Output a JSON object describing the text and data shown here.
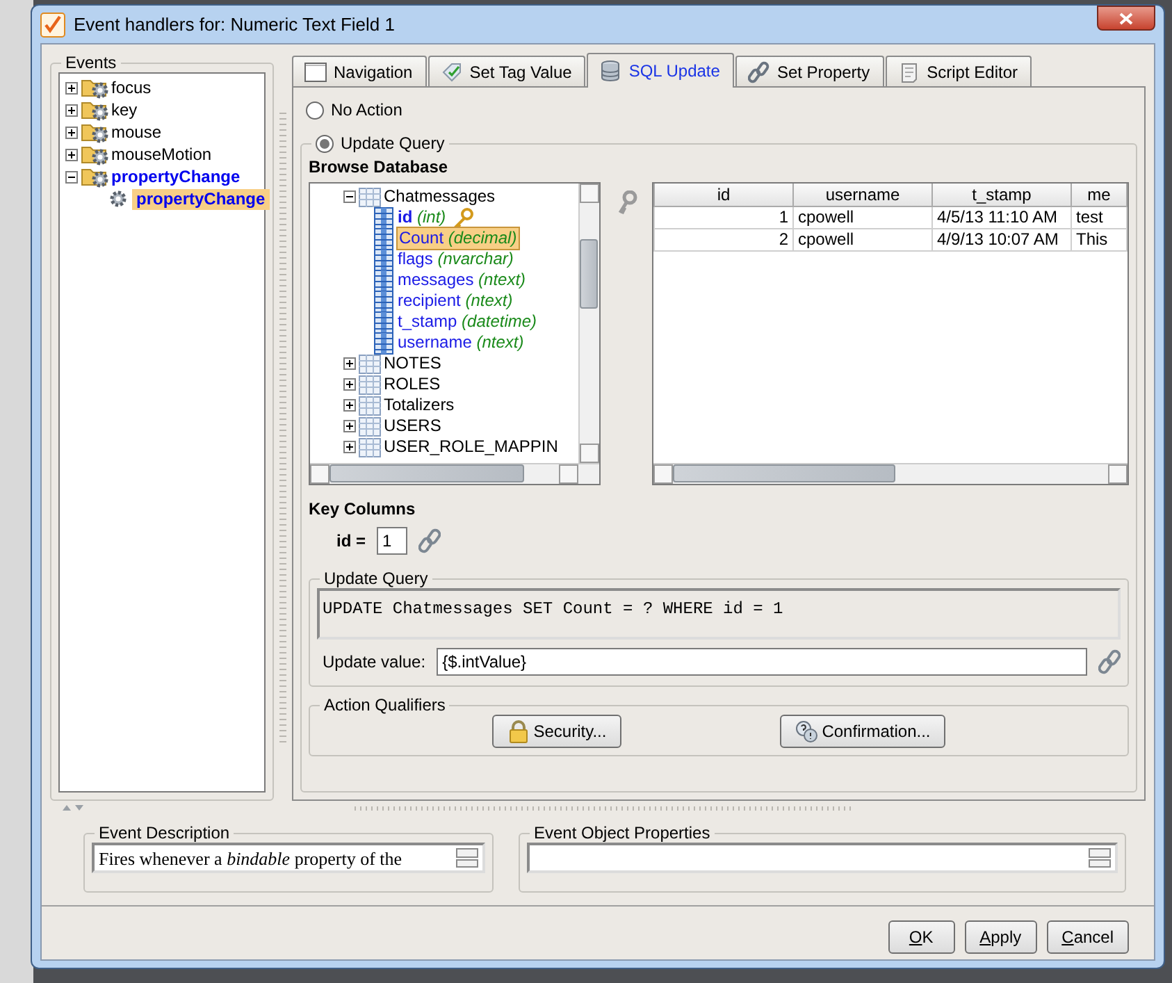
{
  "window": {
    "title": "Event handlers for: Numeric Text Field 1"
  },
  "events": {
    "title": "Events",
    "tree": [
      {
        "label": "focus",
        "expanded": false,
        "configured": false
      },
      {
        "label": "key",
        "expanded": false,
        "configured": false
      },
      {
        "label": "mouse",
        "expanded": false,
        "configured": false
      },
      {
        "label": "mouseMotion",
        "expanded": false,
        "configured": false
      },
      {
        "label": "propertyChange",
        "expanded": true,
        "configured": true,
        "children": [
          {
            "label": "propertyChange",
            "configured": true,
            "selected": true
          }
        ]
      }
    ]
  },
  "tabs": [
    {
      "label": "Navigation",
      "selected": false,
      "kind": "page"
    },
    {
      "label": "Set Tag Value",
      "selected": false,
      "kind": "tag"
    },
    {
      "label": "SQL Update",
      "selected": true,
      "kind": "database"
    },
    {
      "label": "Set Property",
      "selected": false,
      "kind": "link"
    },
    {
      "label": "Script Editor",
      "selected": false,
      "kind": "script"
    }
  ],
  "action_options": [
    {
      "label": "No Action",
      "selected": false
    },
    {
      "label": "Update Query",
      "selected": true
    }
  ],
  "browse_database": {
    "title": "Browse Database",
    "tree": [
      {
        "label": "Chatmessages",
        "expanded": true,
        "children": [
          {
            "name": "id",
            "type": "(int)",
            "key": true,
            "selected": false
          },
          {
            "name": "Count",
            "type": "(decimal)",
            "key": false,
            "selected": true
          },
          {
            "name": "flags",
            "type": "(nvarchar)",
            "key": false,
            "selected": false
          },
          {
            "name": "messages",
            "type": "(ntext)",
            "key": false,
            "selected": false
          },
          {
            "name": "recipient",
            "type": "(ntext)",
            "key": false,
            "selected": false
          },
          {
            "name": "t_stamp",
            "type": "(datetime)",
            "key": false,
            "selected": false
          },
          {
            "name": "username",
            "type": "(ntext)",
            "key": false,
            "selected": false
          }
        ]
      },
      {
        "label": "NOTES",
        "expanded": false
      },
      {
        "label": "ROLES",
        "expanded": false
      },
      {
        "label": "Totalizers",
        "expanded": false
      },
      {
        "label": "USERS",
        "expanded": false
      },
      {
        "label": "USER_ROLE_MAPPIN",
        "expanded": false
      }
    ]
  },
  "table": {
    "columns": [
      "id",
      "username",
      "t_stamp",
      "me"
    ],
    "rows": [
      [
        "1",
        "cpowell",
        "4/5/13 11:10 AM",
        "test"
      ],
      [
        "2",
        "cpowell",
        "4/9/13 10:07 AM",
        "This"
      ]
    ]
  },
  "key_columns": {
    "title": "Key Columns",
    "items": [
      {
        "label": "id =",
        "value": "1"
      }
    ]
  },
  "update_query": {
    "title": "Update Query",
    "sql": "UPDATE Chatmessages SET Count = ? WHERE id = 1",
    "value_label": "Update value:",
    "value": "{$.intValue}"
  },
  "action_qualifiers": {
    "title": "Action Qualifiers",
    "buttons": [
      {
        "label": "Security...",
        "kind": "lock"
      },
      {
        "label": "Confirmation...",
        "kind": "question"
      }
    ]
  },
  "event_description": {
    "title": "Event Description",
    "text": "Fires whenever a *bindable* property of the"
  },
  "event_object_properties": {
    "title": "Event Object Properties"
  },
  "buttons": [
    "OK",
    "Apply",
    "Cancel"
  ]
}
